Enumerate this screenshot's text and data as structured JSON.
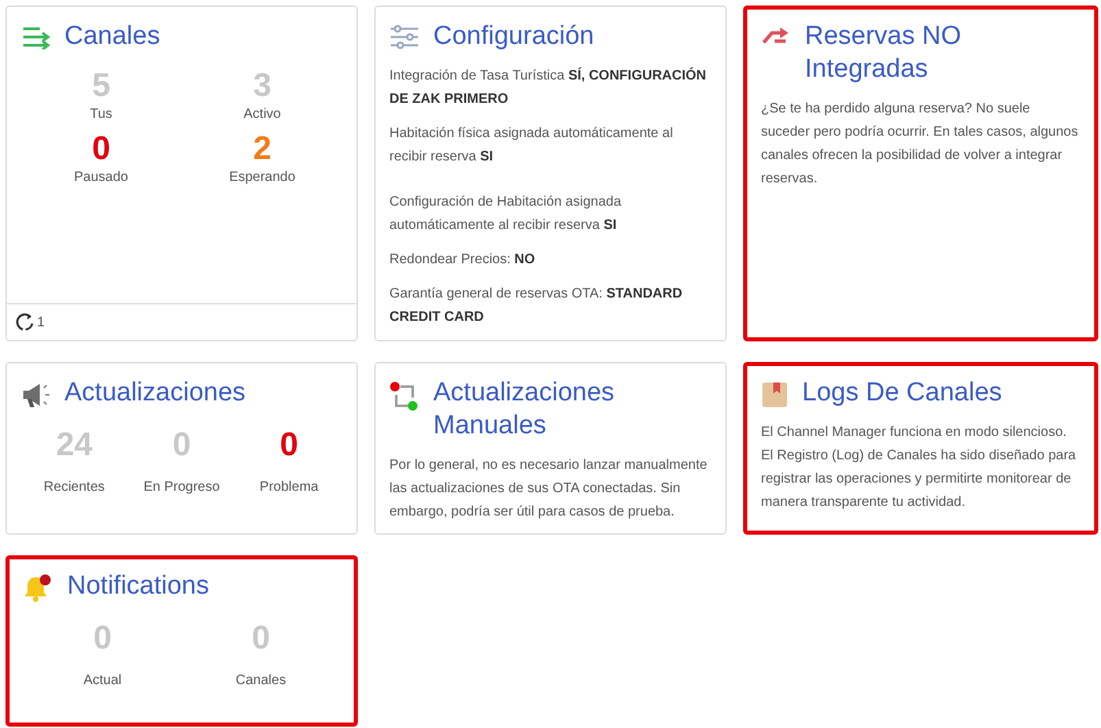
{
  "cards": [
    {
      "kind": "stats",
      "title": "Canales",
      "highlighted": false,
      "stats": [
        {
          "value": "5",
          "label": "Tus",
          "color": "#c8c8c8"
        },
        {
          "value": "3",
          "label": "Activo",
          "color": "#c8c8c8"
        },
        {
          "value": "0",
          "label": "Pausado",
          "color": "#e3000f"
        },
        {
          "value": "2",
          "label": "Esperando",
          "color": "#f07d1a"
        }
      ],
      "footer": {
        "count": "1"
      }
    },
    {
      "kind": "settings",
      "title": "Configuración",
      "highlighted": false,
      "lines": [
        "Integración de Tasa Turística **SÍ, CONFIGURACIÓN DE ZAK PRIMERO**",
        "Habitación física asignada automáticamente al recibir reserva **SI**",
        "Configuración de Habitación asignada automáticamente al recibir reserva **SI**",
        "Redondear Precios: **NO**",
        "Garantía general de reservas OTA: **STANDARD CREDIT CARD**"
      ]
    },
    {
      "kind": "text",
      "title": "Reservas NO Integradas",
      "highlighted": true,
      "text": "¿Se te ha perdido alguna reserva? No suele suceder pero podría ocurrir. En tales casos, algunos canales ofrecen la posibilidad de volver a integrar reservas."
    },
    {
      "kind": "stats",
      "title": "Actualizaciones",
      "highlighted": false,
      "stats": [
        {
          "value": "24",
          "label": "Recientes",
          "color": "#c8c8c8"
        },
        {
          "value": "0",
          "label": "En Progreso",
          "color": "#c8c8c8"
        },
        {
          "value": "0",
          "label": "Problema",
          "color": "#e3000f"
        }
      ]
    },
    {
      "kind": "text",
      "title": "Actualizaciones Manuales",
      "highlighted": false,
      "text": "Por lo general, no es necesario lanzar manualmente las actualizaciones de sus OTA conectadas. Sin embargo, podría ser útil para casos de prueba."
    },
    {
      "kind": "text",
      "title": "Logs De Canales",
      "highlighted": true,
      "text": "El Channel Manager funciona en modo silencioso. El Registro (Log) de Canales ha sido diseñado para registrar las operaciones y permitirte monitorear de manera transparente tu actividad."
    },
    {
      "kind": "stats",
      "title": "Notifications",
      "highlighted": true,
      "stats": [
        {
          "value": "0",
          "label": "Actual",
          "color": "#c8c8c8"
        },
        {
          "value": "0",
          "label": "Canales",
          "color": "#c8c8c8"
        }
      ]
    }
  ]
}
